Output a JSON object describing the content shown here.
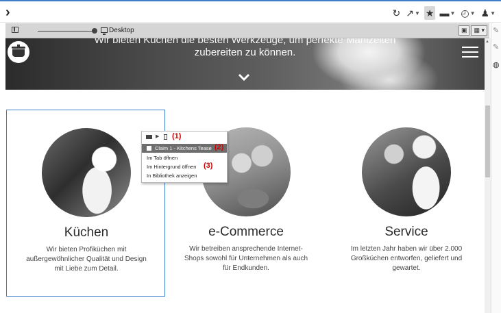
{
  "toolbar": {
    "back_glyph": "›",
    "tools": [
      {
        "name": "refresh-icon",
        "glyph": "↻"
      },
      {
        "name": "open-external-icon",
        "glyph": "↗"
      },
      {
        "name": "star-icon",
        "glyph": "★"
      },
      {
        "name": "image-icon",
        "glyph": "▬"
      },
      {
        "name": "clock-icon",
        "glyph": "◴"
      },
      {
        "name": "user-icon",
        "glyph": "♟"
      }
    ]
  },
  "preview_bar": {
    "device_label": "Desktop"
  },
  "hero": {
    "line1": "Wir bieten Küchen die besten Werkzeuge, um perfekte Mahlzeiten",
    "line2": "zubereiten zu können."
  },
  "services": [
    {
      "title": "Küchen",
      "description": "Wir bieten Profiküchen mit außergewöhnlicher Qualität und Design mit Liebe zum Detail."
    },
    {
      "title": "e-Commerce",
      "description": "Wir betreiben ansprechende Internet-Shops sowohl für Unternehmen als auch für Endkunden."
    },
    {
      "title": "Service",
      "description": "Im letzten Jahr haben wir über 2.000 Großküchen entworfen, geliefert und gewartet."
    }
  ],
  "context_popup": {
    "annotation_1": "(1)",
    "items": [
      {
        "label": "Claim 1 - Kitchens Tease",
        "annotation": "(2)"
      },
      {
        "label": "Im Tab öffnen",
        "annotation": ""
      },
      {
        "label": "Im Hintergrund öffnen",
        "annotation": "(3)"
      },
      {
        "label": "In Bibliothek anzeigen",
        "annotation": ""
      }
    ]
  },
  "colors": {
    "accent": "#3d7cc9",
    "annotation_red": "#d40000",
    "highlight_row": "#6e6e6e"
  }
}
